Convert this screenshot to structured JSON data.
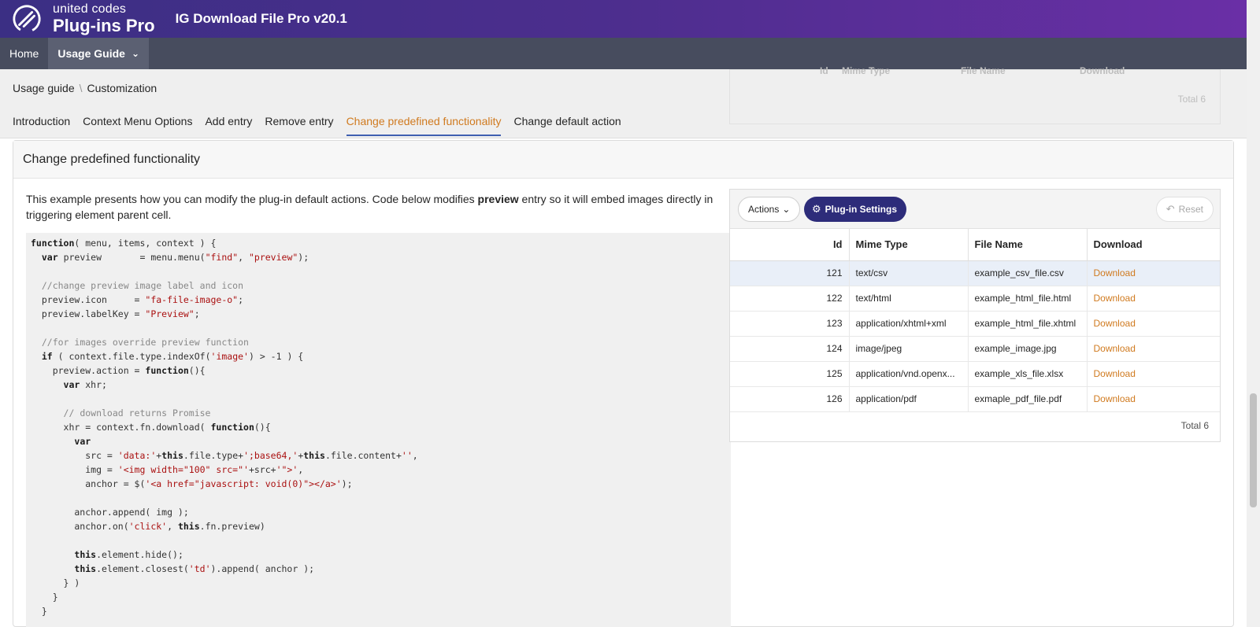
{
  "header": {
    "brand_top": "united codes",
    "brand_bottom": "Plug-ins Pro",
    "app_title": "IG Download File Pro v20.1"
  },
  "nav": {
    "items": [
      {
        "label": "Home"
      },
      {
        "label": "Usage Guide"
      }
    ]
  },
  "breadcrumb": {
    "parent": "Usage guide",
    "separator": "\\",
    "current": "Customization"
  },
  "tabs": [
    {
      "label": "Introduction"
    },
    {
      "label": "Context Menu Options"
    },
    {
      "label": "Add entry"
    },
    {
      "label": "Remove entry"
    },
    {
      "label": "Change predefined functionality",
      "active": true
    },
    {
      "label": "Change default action"
    }
  ],
  "ghost": {
    "col1": "Id",
    "col2": "Mime Type",
    "col3": "File Name",
    "col4": "Download",
    "total": "Total 6"
  },
  "card": {
    "title": "Change predefined functionality",
    "intro_a": "This example presents how you can modify the plug-in default actions. Code below modifies ",
    "intro_b": "preview",
    "intro_c": " entry so it will embed images directly in triggering element parent cell."
  },
  "grid": {
    "actions_label": "Actions",
    "settings_label": "Plug-in Settings",
    "reset_label": "Reset",
    "columns": [
      "Id",
      "Mime Type",
      "File Name",
      "Download"
    ],
    "rows": [
      {
        "id": "121",
        "mime": "text/csv",
        "file": "example_csv_file.csv",
        "download": "Download"
      },
      {
        "id": "122",
        "mime": "text/html",
        "file": "example_html_file.html",
        "download": "Download"
      },
      {
        "id": "123",
        "mime": "application/xhtml+xml",
        "file": "example_html_file.xhtml",
        "download": "Download"
      },
      {
        "id": "124",
        "mime": "image/jpeg",
        "file": "example_image.jpg",
        "download": "Download"
      },
      {
        "id": "125",
        "mime": "application/vnd.openx...",
        "file": "example_xls_file.xlsx",
        "download": "Download"
      },
      {
        "id": "126",
        "mime": "application/pdf",
        "file": "exmaple_pdf_file.pdf",
        "download": "Download"
      }
    ],
    "total": "Total 6"
  },
  "colors": {
    "header_start": "#3b2f84",
    "header_end": "#6a2fa6",
    "nav_bg": "#474c5e",
    "accent_orange": "#d07a1f",
    "settings_button": "#2d2c7a",
    "tab_underline": "#3f5fb0"
  },
  "icons": {
    "logo": "united-codes-logo-icon",
    "chevron": "chevron-down-icon",
    "gear": "gear-icon",
    "reset": "reset-icon"
  }
}
